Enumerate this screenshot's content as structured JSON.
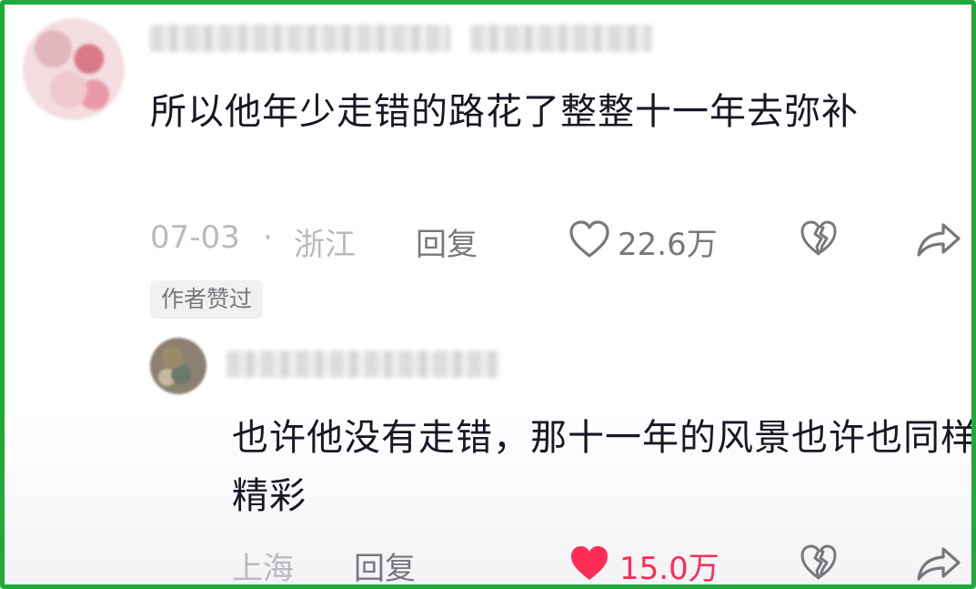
{
  "comment": {
    "text": "所以他年少走错的路花了整整十一年去弥补",
    "date": "07-03",
    "separator": "·",
    "location": "浙江",
    "reply_label": "回复",
    "like_count": "22.6万",
    "author_badge": "作者赞过",
    "icons": {
      "like": "heart-outline-icon",
      "dislike": "broken-heart-icon",
      "share": "share-arrow-icon"
    }
  },
  "reply": {
    "text": "也许他没有走错，那十一年的风景也许也同样精彩",
    "location": "上海",
    "reply_label": "回复",
    "like_count": "15.0万",
    "liked": true,
    "icons": {
      "like": "heart-filled-icon",
      "dislike": "broken-heart-icon",
      "share": "share-arrow-icon"
    }
  },
  "colors": {
    "frame": "#1faa3b",
    "like_active": "#fe2c55",
    "meta_text": "#b9babe",
    "action_text": "#77787c"
  }
}
